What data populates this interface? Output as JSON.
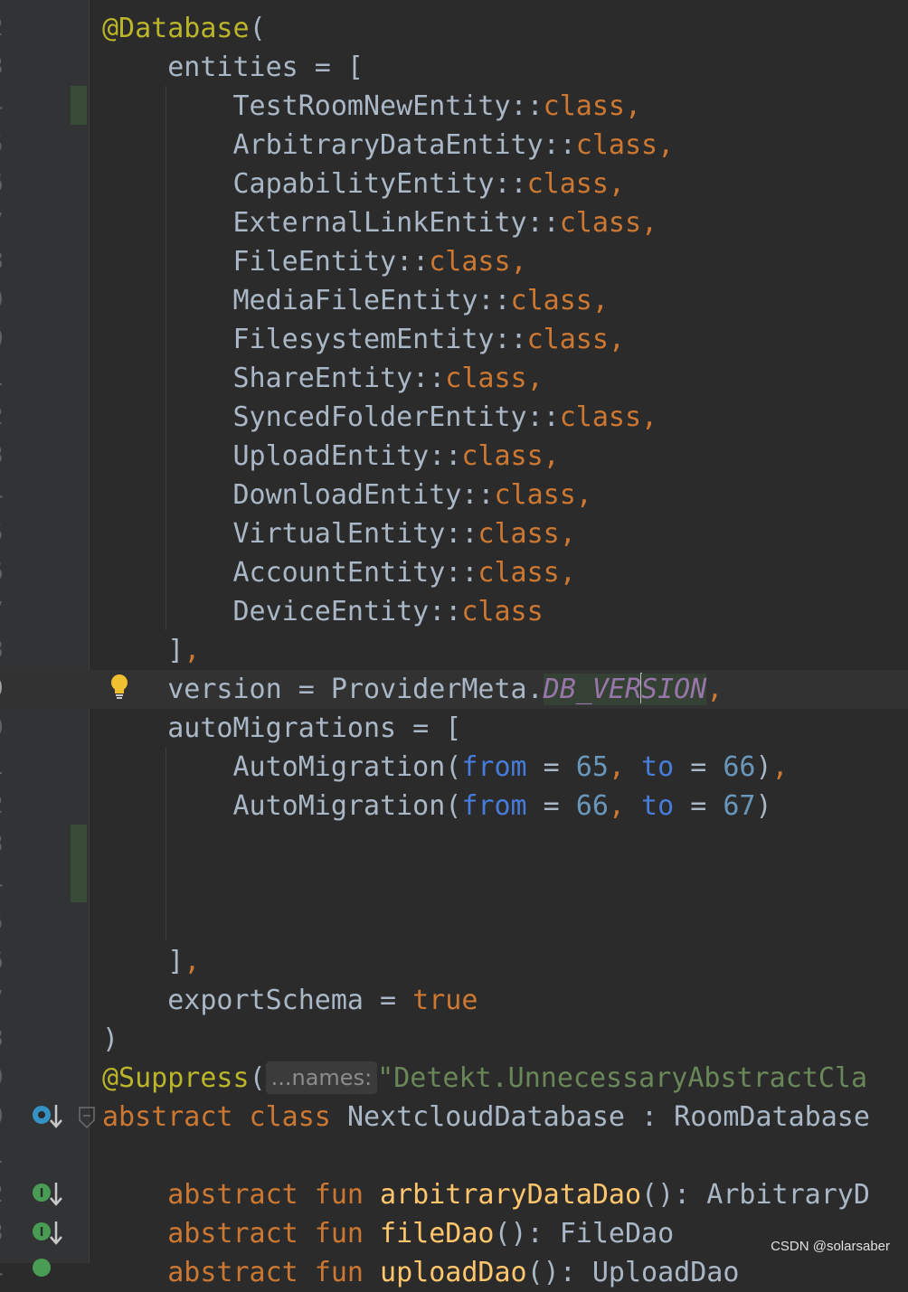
{
  "editor": {
    "language": "Kotlin",
    "lines": [
      {
        "num": "2",
        "segments": [
          {
            "t": "@Database",
            "c": "ann"
          },
          {
            "t": "(",
            "c": "op"
          }
        ]
      },
      {
        "num": "3",
        "segments": [
          {
            "t": "    entities = [",
            "c": "op"
          }
        ]
      },
      {
        "num": "4",
        "segments": [
          {
            "t": "        TestRoomNewEntity::",
            "c": "op"
          },
          {
            "t": "class",
            "c": "kw"
          },
          {
            "t": ",",
            "c": "kw"
          }
        ]
      },
      {
        "num": "5",
        "segments": [
          {
            "t": "        ArbitraryDataEntity::",
            "c": "op"
          },
          {
            "t": "class",
            "c": "kw"
          },
          {
            "t": ",",
            "c": "kw"
          }
        ]
      },
      {
        "num": "6",
        "segments": [
          {
            "t": "        CapabilityEntity::",
            "c": "op"
          },
          {
            "t": "class",
            "c": "kw"
          },
          {
            "t": ",",
            "c": "kw"
          }
        ]
      },
      {
        "num": "7",
        "segments": [
          {
            "t": "        ExternalLinkEntity::",
            "c": "op"
          },
          {
            "t": "class",
            "c": "kw"
          },
          {
            "t": ",",
            "c": "kw"
          }
        ]
      },
      {
        "num": "8",
        "segments": [
          {
            "t": "        FileEntity::",
            "c": "op"
          },
          {
            "t": "class",
            "c": "kw"
          },
          {
            "t": ",",
            "c": "kw"
          }
        ]
      },
      {
        "num": "9",
        "segments": [
          {
            "t": "        MediaFileEntity::",
            "c": "op"
          },
          {
            "t": "class",
            "c": "kw"
          },
          {
            "t": ",",
            "c": "kw"
          }
        ]
      },
      {
        "num": "0",
        "segments": [
          {
            "t": "        FilesystemEntity::",
            "c": "op"
          },
          {
            "t": "class",
            "c": "kw"
          },
          {
            "t": ",",
            "c": "kw"
          }
        ]
      },
      {
        "num": "1",
        "segments": [
          {
            "t": "        ShareEntity::",
            "c": "op"
          },
          {
            "t": "class",
            "c": "kw"
          },
          {
            "t": ",",
            "c": "kw"
          }
        ]
      },
      {
        "num": "2",
        "segments": [
          {
            "t": "        SyncedFolderEntity::",
            "c": "op"
          },
          {
            "t": "class",
            "c": "kw"
          },
          {
            "t": ",",
            "c": "kw"
          }
        ]
      },
      {
        "num": "3",
        "segments": [
          {
            "t": "        UploadEntity::",
            "c": "op"
          },
          {
            "t": "class",
            "c": "kw"
          },
          {
            "t": ",",
            "c": "kw"
          }
        ]
      },
      {
        "num": "4",
        "segments": [
          {
            "t": "        DownloadEntity::",
            "c": "op"
          },
          {
            "t": "class",
            "c": "kw"
          },
          {
            "t": ",",
            "c": "kw"
          }
        ]
      },
      {
        "num": "5",
        "segments": [
          {
            "t": "        VirtualEntity::",
            "c": "op"
          },
          {
            "t": "class",
            "c": "kw"
          },
          {
            "t": ",",
            "c": "kw"
          }
        ]
      },
      {
        "num": "6",
        "segments": [
          {
            "t": "        AccountEntity::",
            "c": "op"
          },
          {
            "t": "class",
            "c": "kw"
          },
          {
            "t": ",",
            "c": "kw"
          }
        ]
      },
      {
        "num": "7",
        "segments": [
          {
            "t": "        DeviceEntity::",
            "c": "op"
          },
          {
            "t": "class",
            "c": "kw"
          }
        ]
      },
      {
        "num": "8",
        "segments": [
          {
            "t": "    ]",
            "c": "op"
          },
          {
            "t": ",",
            "c": "kw"
          }
        ]
      },
      {
        "num": "9",
        "current": true,
        "segments": [
          {
            "t": "    version = ProviderMeta.",
            "c": "op"
          },
          {
            "t": "DB_VER",
            "c": "const"
          },
          {
            "t": "",
            "c": "caret"
          },
          {
            "t": "SION",
            "c": "const"
          },
          {
            "t": ",",
            "c": "kw"
          }
        ]
      },
      {
        "num": "0",
        "segments": [
          {
            "t": "    autoMigrations = [",
            "c": "op"
          }
        ]
      },
      {
        "num": "1",
        "segments": [
          {
            "t": "        AutoMigration(",
            "c": "op"
          },
          {
            "t": "from",
            "c": "param"
          },
          {
            "t": " = ",
            "c": "op"
          },
          {
            "t": "65",
            "c": "num"
          },
          {
            "t": ", ",
            "c": "kw"
          },
          {
            "t": "to",
            "c": "param"
          },
          {
            "t": " = ",
            "c": "op"
          },
          {
            "t": "66",
            "c": "num"
          },
          {
            "t": ")",
            "c": "op"
          },
          {
            "t": ",",
            "c": "kw"
          }
        ]
      },
      {
        "num": "2",
        "segments": [
          {
            "t": "        AutoMigration(",
            "c": "op"
          },
          {
            "t": "from",
            "c": "param"
          },
          {
            "t": " = ",
            "c": "op"
          },
          {
            "t": "66",
            "c": "num"
          },
          {
            "t": ", ",
            "c": "kw"
          },
          {
            "t": "to",
            "c": "param"
          },
          {
            "t": " = ",
            "c": "op"
          },
          {
            "t": "67",
            "c": "num"
          },
          {
            "t": ")",
            "c": "op"
          }
        ]
      },
      {
        "num": "3",
        "segments": []
      },
      {
        "num": "4",
        "segments": []
      },
      {
        "num": "5",
        "segments": []
      },
      {
        "num": "6",
        "segments": [
          {
            "t": "    ]",
            "c": "op"
          },
          {
            "t": ",",
            "c": "kw"
          }
        ]
      },
      {
        "num": "7",
        "segments": [
          {
            "t": "    exportSchema = ",
            "c": "op"
          },
          {
            "t": "true",
            "c": "kw"
          }
        ]
      },
      {
        "num": "8",
        "segments": [
          {
            "t": ")",
            "c": "op"
          }
        ]
      },
      {
        "num": "9",
        "segments": [
          {
            "t": "@Suppress",
            "c": "ann"
          },
          {
            "t": "(",
            "c": "op"
          },
          {
            "t": "...names:",
            "c": "hint"
          },
          {
            "t": "\"Detekt.UnnecessaryAbstractCla",
            "c": "str"
          }
        ]
      },
      {
        "num": "0",
        "segments": [
          {
            "t": "abstract class ",
            "c": "kw"
          },
          {
            "t": "NextcloudDatabase : RoomDatabase",
            "c": "op"
          }
        ]
      },
      {
        "num": "1",
        "segments": []
      },
      {
        "num": "2",
        "segments": [
          {
            "t": "    abstract fun ",
            "c": "kw"
          },
          {
            "t": "arbitraryDataDao",
            "c": "fn"
          },
          {
            "t": "(): ArbitraryD",
            "c": "op"
          }
        ]
      },
      {
        "num": "3",
        "segments": [
          {
            "t": "    abstract fun ",
            "c": "kw"
          },
          {
            "t": "fileDao",
            "c": "fn"
          },
          {
            "t": "(): FileDao",
            "c": "op"
          }
        ]
      },
      {
        "num": "4",
        "segments": [
          {
            "t": "    abstract fun ",
            "c": "kw"
          },
          {
            "t": "uploadDao",
            "c": "fn"
          },
          {
            "t": "(): UploadDao",
            "c": "op"
          }
        ]
      }
    ]
  },
  "gutter_icons": {
    "bulb": "lightbulb-icon",
    "implemented": "implemented-icon",
    "implementing": "implementing-icon",
    "fold": "fold-icon"
  },
  "watermark": "CSDN @solarsaber"
}
